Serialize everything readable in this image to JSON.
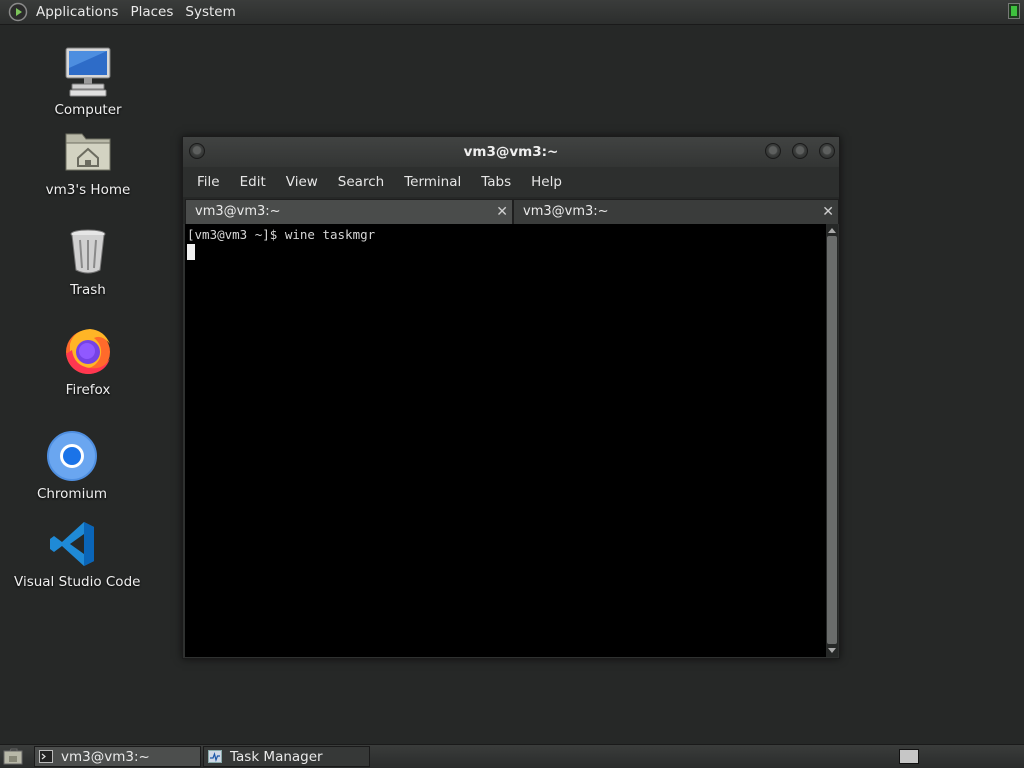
{
  "top_panel": {
    "menus": [
      "Applications",
      "Places",
      "System"
    ]
  },
  "desktop_icons": [
    {
      "label": "Computer",
      "icon": "computer-icon"
    },
    {
      "label": "vm3's Home",
      "icon": "home-folder-icon"
    },
    {
      "label": "Trash",
      "icon": "trash-icon"
    },
    {
      "label": "Firefox",
      "icon": "firefox-icon"
    },
    {
      "label": "Chromium",
      "icon": "chromium-icon"
    },
    {
      "label": "Visual Studio Code",
      "icon": "vscode-icon"
    }
  ],
  "terminal": {
    "title": "vm3@vm3:~",
    "menu": [
      "File",
      "Edit",
      "View",
      "Search",
      "Terminal",
      "Tabs",
      "Help"
    ],
    "tabs": [
      {
        "label": "vm3@vm3:~",
        "active": true
      },
      {
        "label": "vm3@vm3:~",
        "active": false
      }
    ],
    "output_line": "[vm3@vm3 ~]$ wine taskmgr"
  },
  "taskbar": {
    "tasks": [
      {
        "label": "vm3@vm3:~",
        "icon": "terminal-icon",
        "active": true
      },
      {
        "label": "Task Manager",
        "icon": "task-manager-icon",
        "active": false
      }
    ]
  },
  "colors": {
    "desktop_bg": "#262827",
    "terminal_bg": "#000000",
    "panel_bg": "#333534"
  }
}
